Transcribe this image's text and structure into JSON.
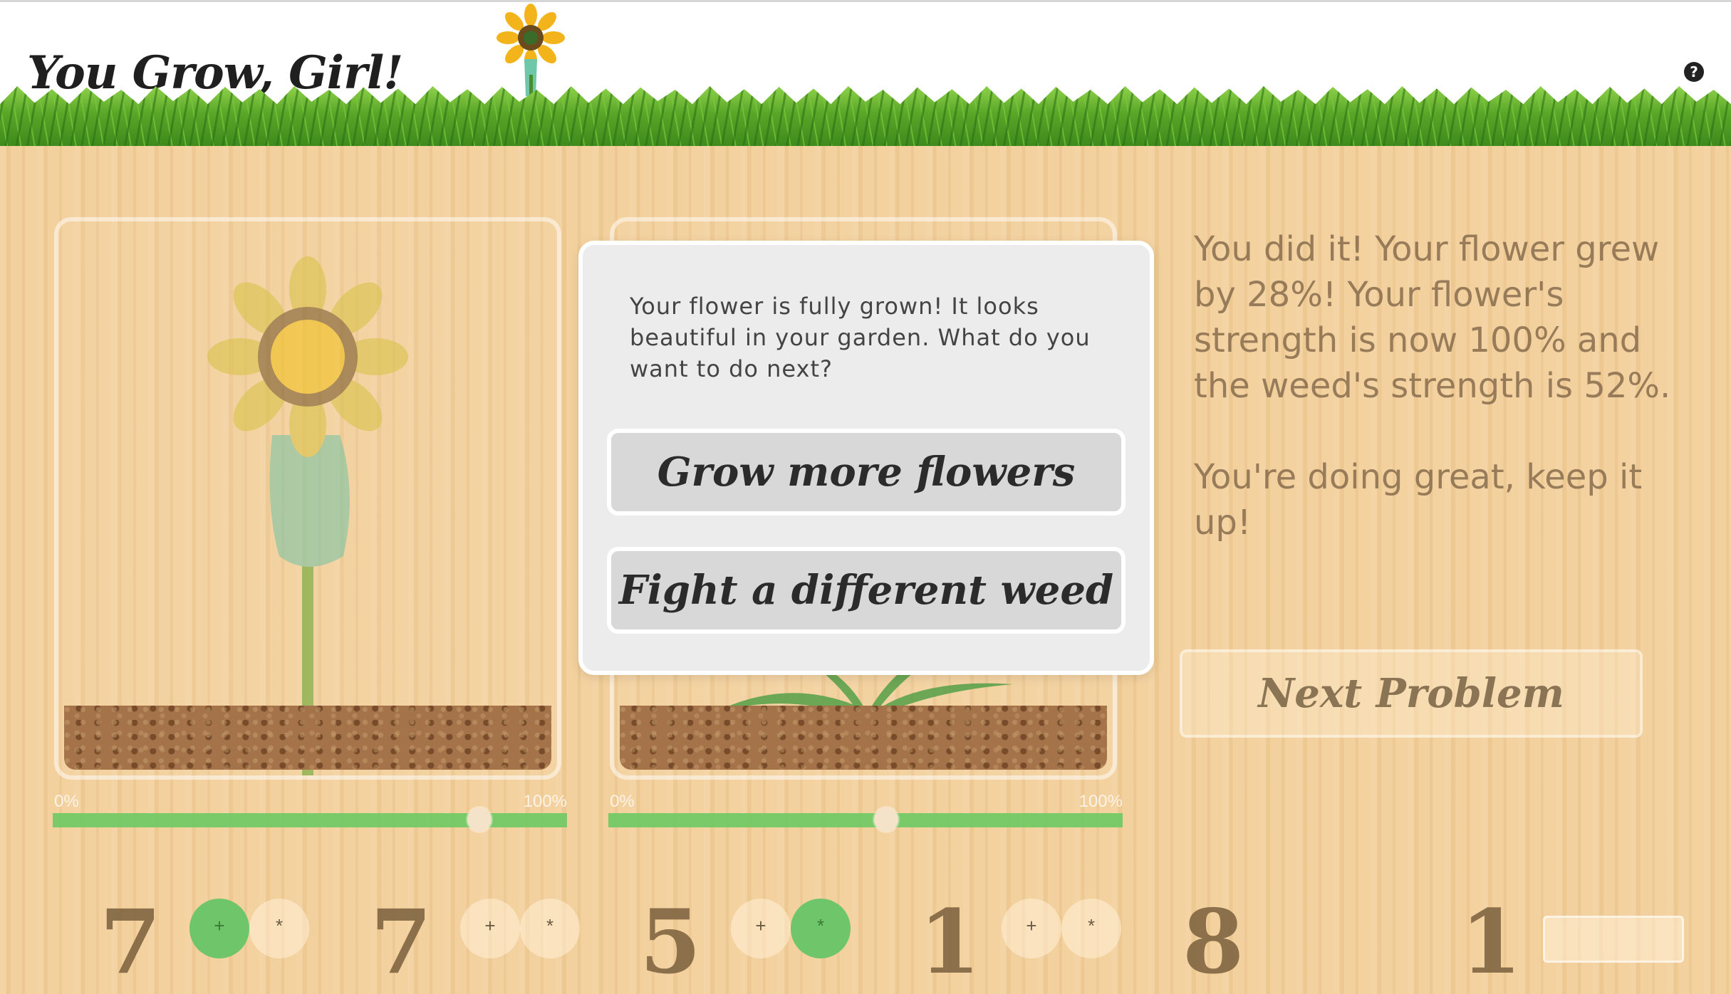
{
  "header": {
    "title": "You Grow, Girl!",
    "help_icon": "question-circle-icon",
    "decoration_icon": "sunflower-icon"
  },
  "pots": [
    {
      "plant_icon": "sunflower-icon",
      "range": {
        "min_label": "0%",
        "max_label": "100%"
      },
      "strength": 0.83
    },
    {
      "plant_icon": "weed-icon",
      "range": {
        "min_label": "0%",
        "max_label": "100%"
      },
      "strength": 0.54
    }
  ],
  "modal": {
    "message": "Your flower is fully grown! It looks beautiful in your garden. What do you want to do next?",
    "grow_label": "Grow more flowers",
    "fight_label": "Fight a different weed"
  },
  "feedback": {
    "result": "You did it! Your flower grew by 28%! Your flower's strength is now 100% and the weed's strength is 52%.",
    "encouragement": "You're doing great, keep it up!"
  },
  "next_label": "Next Problem",
  "problem_row": {
    "digits": [
      "7",
      "7",
      "5",
      "1",
      "8",
      "1"
    ],
    "operators": [
      {
        "plus": "+",
        "times": "*",
        "selected": "plus"
      },
      {
        "plus": "+",
        "times": "*",
        "selected": "none"
      },
      {
        "plus": "+",
        "times": "*",
        "selected": "times"
      },
      {
        "plus": "+",
        "times": "*",
        "selected": "none"
      }
    ]
  },
  "colors": {
    "grass": "#5aa628",
    "slider_fill": "#73c966",
    "wood": "#f3cf9a",
    "modal_bg": "#ececec"
  }
}
